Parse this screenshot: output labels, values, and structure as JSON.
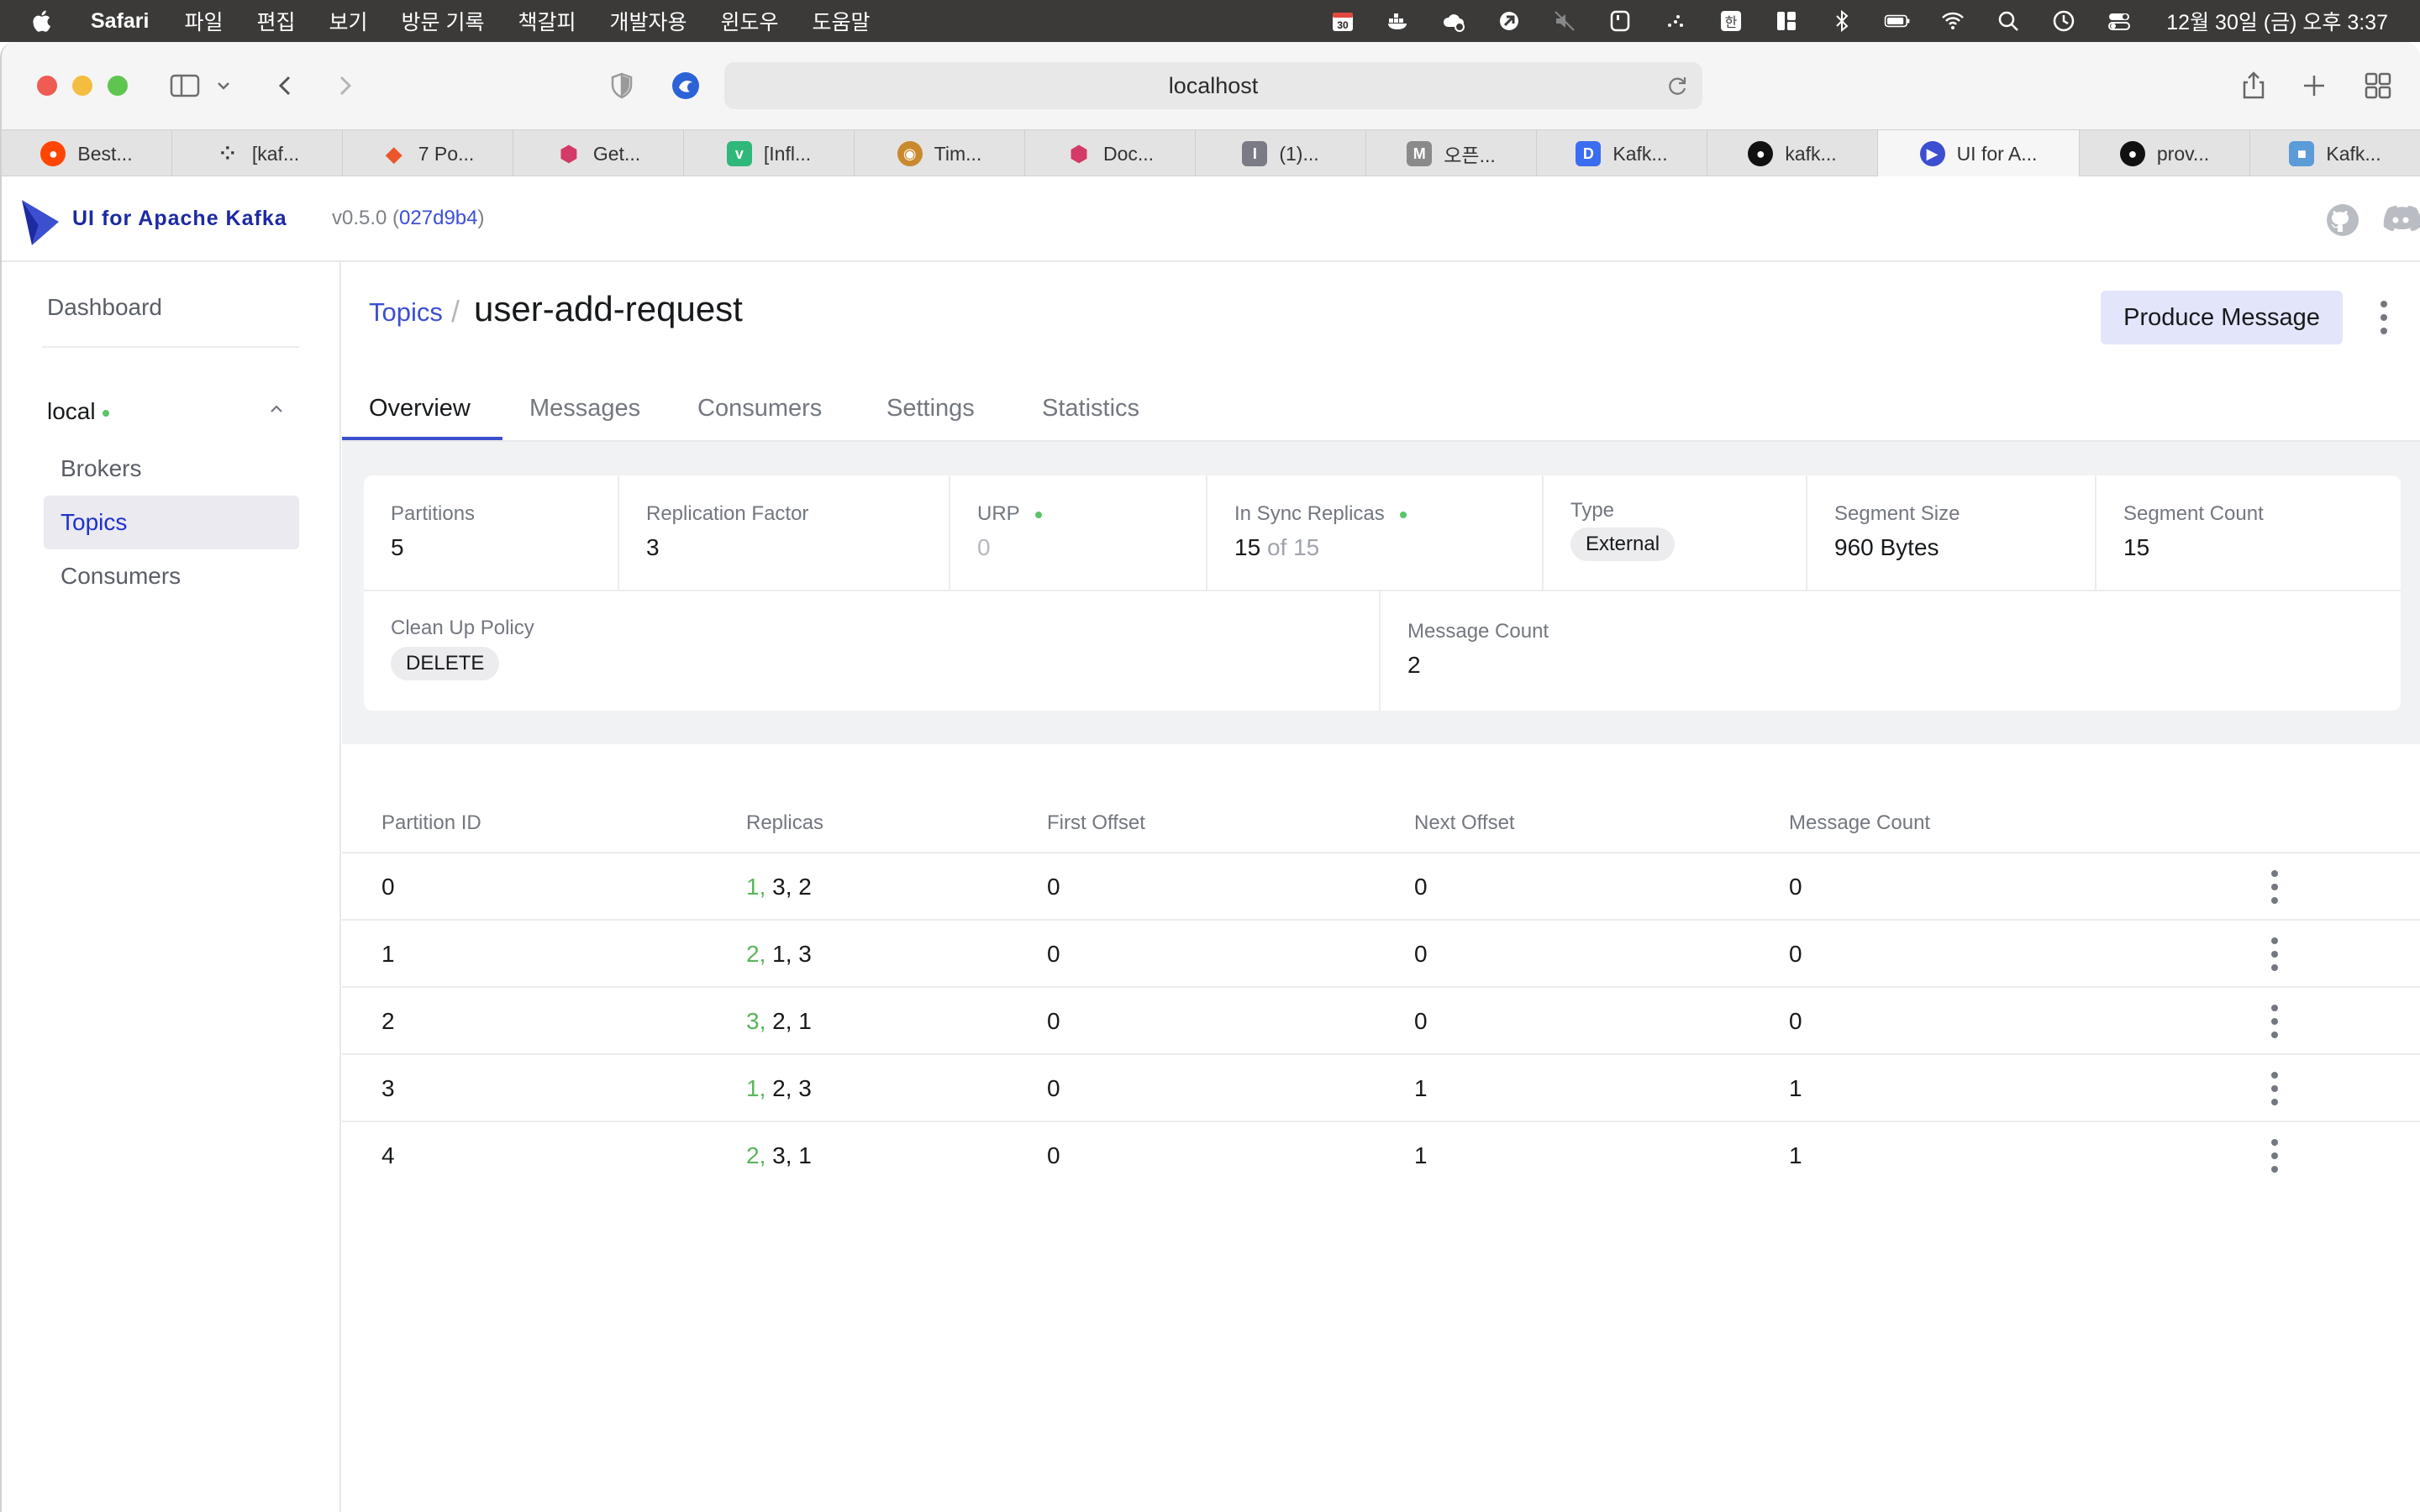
{
  "menubar": {
    "app_name": "Safari",
    "items": [
      "파일",
      "편집",
      "보기",
      "방문 기록",
      "책갈피",
      "개발자용",
      "윈도우",
      "도움말"
    ],
    "clock": "12월 30일 (금) 오후 3:37",
    "calendar_day": "30",
    "input_method": "한"
  },
  "browser": {
    "url": "localhost",
    "tabs": [
      {
        "label": "Best...",
        "icon": "reddit-icon",
        "color": "#ff4500"
      },
      {
        "label": "[kaf...",
        "icon": "dots-icon",
        "color": "#333333"
      },
      {
        "label": "7 Po...",
        "icon": "diamond-icon",
        "color": "#e9572b"
      },
      {
        "label": "Get...",
        "icon": "gem-icon",
        "color": "#d33a66"
      },
      {
        "label": "[Infl...",
        "icon": "v-icon",
        "color": "#2fb87a"
      },
      {
        "label": "Tim...",
        "icon": "tiger-icon",
        "color": "#c98a2e"
      },
      {
        "label": "Doc...",
        "icon": "gem-icon",
        "color": "#d33a66"
      },
      {
        "label": "(1)...",
        "icon": "i-icon",
        "color": "#7b7b86"
      },
      {
        "label": "오픈...",
        "icon": "m-icon",
        "color": "#8a8a8a"
      },
      {
        "label": "Kafk...",
        "icon": "d-icon",
        "color": "#3a6df0"
      },
      {
        "label": "kafk...",
        "icon": "github-icon",
        "color": "#111111"
      },
      {
        "label": "UI for A...",
        "icon": "kafka-ui-icon",
        "color": "#3c4fd0"
      },
      {
        "label": "prov...",
        "icon": "github-icon",
        "color": "#111111"
      },
      {
        "label": "Kafk...",
        "icon": "cube-icon",
        "color": "#5a9bd8"
      }
    ]
  },
  "app": {
    "brand": "UI for Apache Kafka",
    "version_prefix": "v0.5.0 (",
    "commit": "027d9b4",
    "version_suffix": ")"
  },
  "sidebar": {
    "dashboard": "Dashboard",
    "cluster": "local",
    "items": [
      "Brokers",
      "Topics",
      "Consumers"
    ]
  },
  "topic": {
    "breadcrumb": "Topics",
    "separator": "/",
    "name": "user-add-request",
    "produce_label": "Produce Message",
    "tabs": [
      "Overview",
      "Messages",
      "Consumers",
      "Settings",
      "Statistics"
    ]
  },
  "stats": {
    "partitions": {
      "label": "Partitions",
      "value": "5"
    },
    "replication": {
      "label": "Replication Factor",
      "value": "3"
    },
    "urp": {
      "label": "URP",
      "value": "0"
    },
    "isr": {
      "label": "In Sync Replicas",
      "value": "15",
      "of": "of 15"
    },
    "type": {
      "label": "Type",
      "value": "External"
    },
    "segment_size": {
      "label": "Segment Size",
      "value": "960 Bytes"
    },
    "segment_count": {
      "label": "Segment Count",
      "value": "15"
    },
    "cleanup": {
      "label": "Clean Up Policy",
      "value": "DELETE"
    },
    "message_count": {
      "label": "Message Count",
      "value": "2"
    }
  },
  "table": {
    "headers": [
      "Partition ID",
      "Replicas",
      "First Offset",
      "Next Offset",
      "Message Count"
    ],
    "rows": [
      {
        "id": "0",
        "leader": "1,",
        "replicas": " 3, 2",
        "first": "0",
        "next": "0",
        "count": "0"
      },
      {
        "id": "1",
        "leader": "2,",
        "replicas": " 1, 3",
        "first": "0",
        "next": "0",
        "count": "0"
      },
      {
        "id": "2",
        "leader": "3,",
        "replicas": " 2, 1",
        "first": "0",
        "next": "0",
        "count": "0"
      },
      {
        "id": "3",
        "leader": "1,",
        "replicas": " 2, 3",
        "first": "0",
        "next": "1",
        "count": "1"
      },
      {
        "id": "4",
        "leader": "2,",
        "replicas": " 3, 1",
        "first": "0",
        "next": "1",
        "count": "1"
      }
    ]
  },
  "colors": {
    "accent": "#3c4fd0",
    "leader": "#5ab55b",
    "status_dot": "#5ac56b"
  }
}
